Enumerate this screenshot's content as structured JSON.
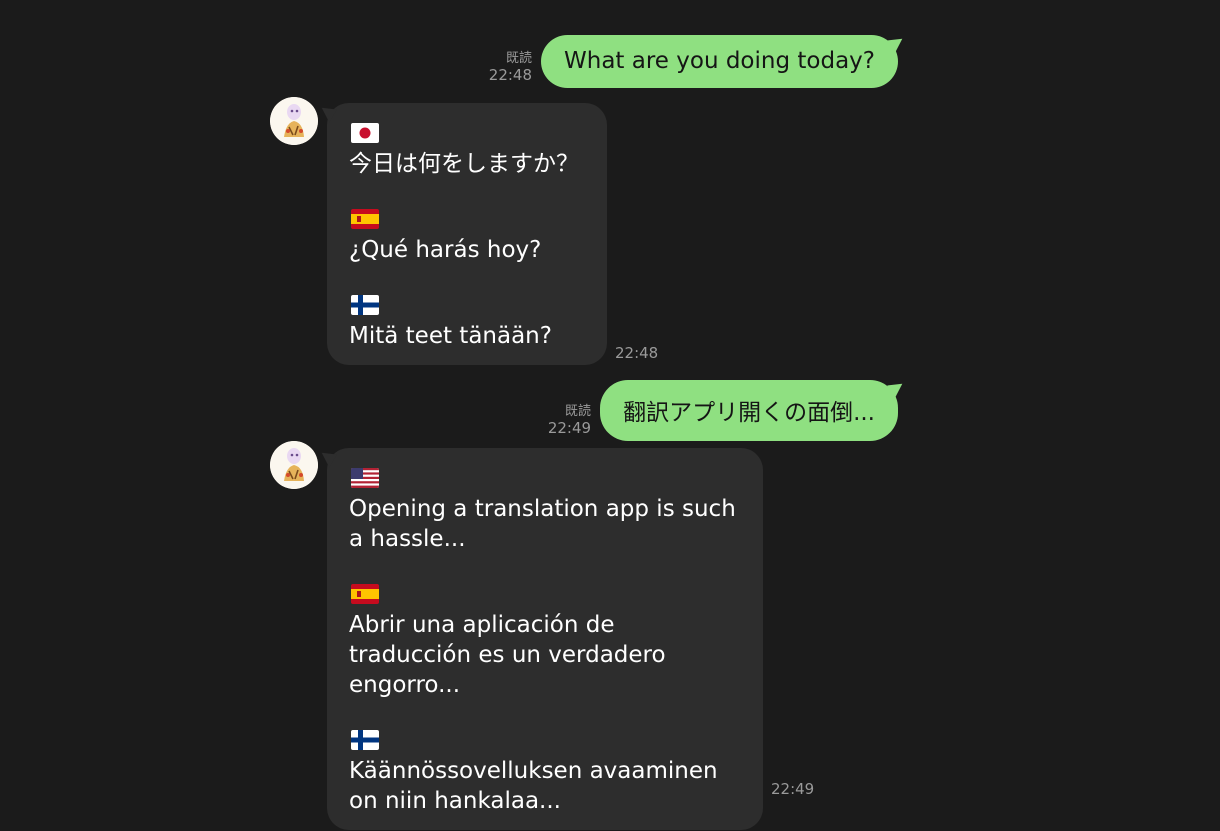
{
  "colors": {
    "background": "#1b1b1b",
    "outgoing_bubble": "#8fe081",
    "incoming_bubble": "#2d2d2d",
    "meta_text": "#9a9a9a"
  },
  "messages": [
    {
      "direction": "outgoing",
      "read_label": "既読",
      "time": "22:48",
      "text": "What are you doing today?"
    },
    {
      "direction": "incoming",
      "avatar": "cartoon-character-avatar",
      "time": "22:48",
      "translations": [
        {
          "flag": "japan-flag",
          "text": "今日は何をしますか？"
        },
        {
          "flag": "spain-flag",
          "text": "¿Qué harás hoy?"
        },
        {
          "flag": "finland-flag",
          "text": "Mitä teet tänään?"
        }
      ]
    },
    {
      "direction": "outgoing",
      "read_label": "既読",
      "time": "22:49",
      "text": "翻訳アプリ開くの面倒..."
    },
    {
      "direction": "incoming",
      "avatar": "cartoon-character-avatar",
      "time": "22:49",
      "translations": [
        {
          "flag": "usa-flag",
          "text": "Opening a translation app is such a hassle..."
        },
        {
          "flag": "spain-flag",
          "text": "Abrir una aplicación de traducción es un verdadero engorro..."
        },
        {
          "flag": "finland-flag",
          "text": "Käännössovelluksen avaaminen on niin hankalaa..."
        }
      ]
    }
  ]
}
